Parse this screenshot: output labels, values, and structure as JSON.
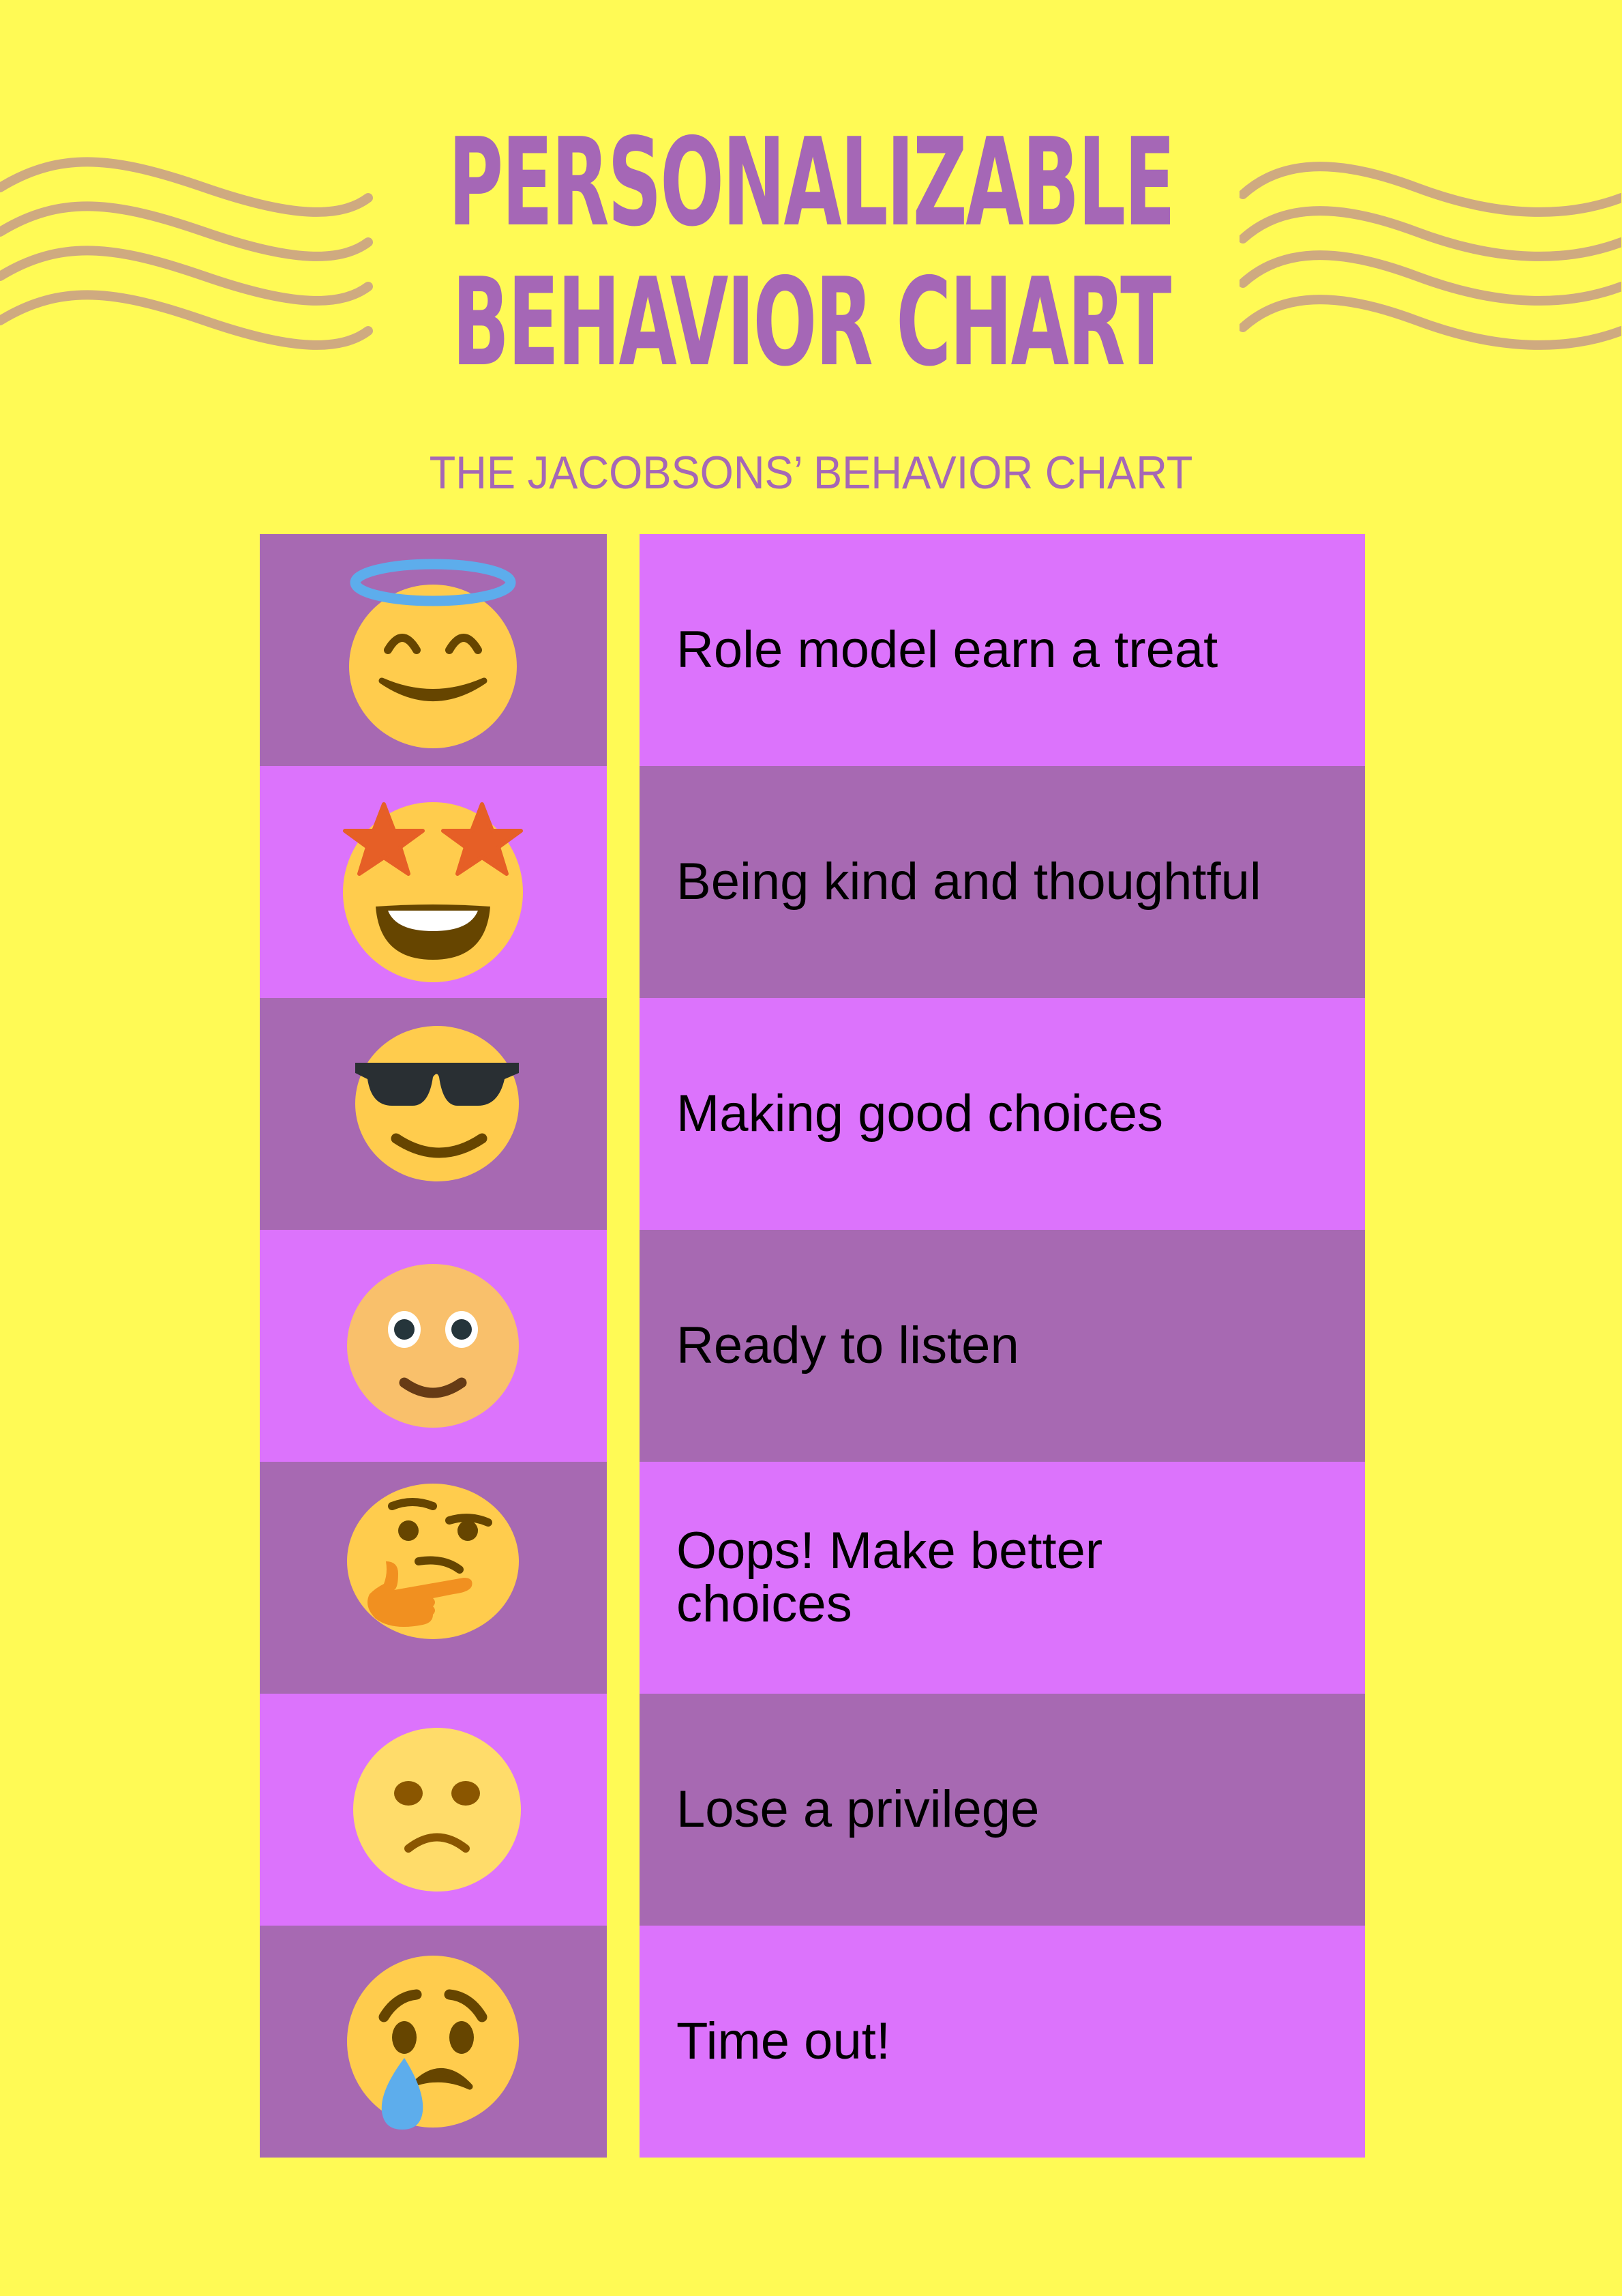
{
  "header": {
    "title_line1": "PERSONALIZABLE",
    "title_line2": "BEHAVIOR CHART",
    "subtitle": "THE JACOBSONS’ BEHAVIOR CHART"
  },
  "colors": {
    "background": "#fffa55",
    "title": "#a567b6",
    "wave": "#cfaa80",
    "cell_dark": "#a769b2",
    "cell_light": "#dc73fc",
    "emoji_face": "#ffcc4d",
    "emoji_feature": "#664500"
  },
  "rows": [
    {
      "emoji": "smiling-face-with-halo",
      "label": "Role model earn a treat"
    },
    {
      "emoji": "star-struck",
      "label": "Being kind and thoughtful"
    },
    {
      "emoji": "smiling-face-with-sunglasses",
      "label": "Making good choices"
    },
    {
      "emoji": "slightly-smiling-face",
      "label": "Ready to listen"
    },
    {
      "emoji": "thinking-face",
      "label": "Oops! Make better choices"
    },
    {
      "emoji": "slightly-frowning-face",
      "label": "Lose a privilege"
    },
    {
      "emoji": "crying-face",
      "label": "Time out!"
    }
  ]
}
